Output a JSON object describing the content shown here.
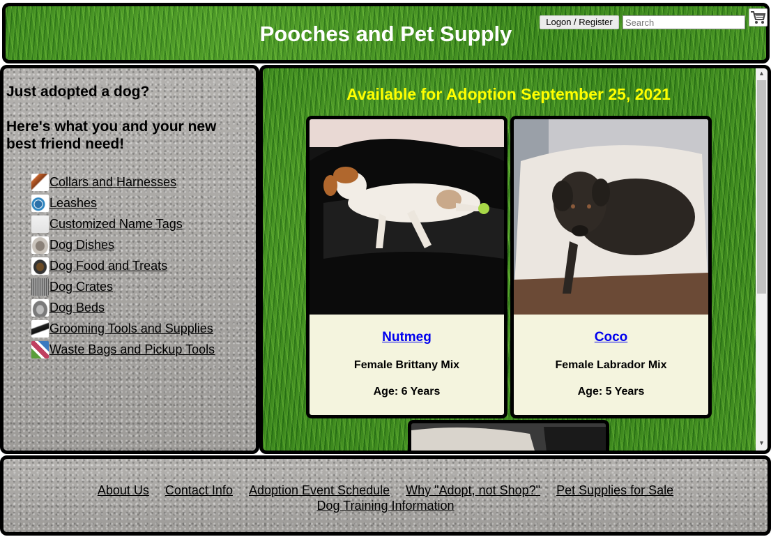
{
  "header": {
    "title": "Pooches and Pet Supply",
    "logon_label": "Logon / Register",
    "search_placeholder": "Search",
    "cart_icon": "shopping-cart-icon"
  },
  "sidebar": {
    "heading_1": "Just adopted a dog?",
    "heading_2": "Here's what you and your new best friend need!",
    "items": [
      {
        "label": "Collars and Harnesses",
        "icon": "collar-thumbnail"
      },
      {
        "label": "Leashes",
        "icon": "leash-thumbnail"
      },
      {
        "label": "Customized Name Tags",
        "icon": "name-tag-thumbnail"
      },
      {
        "label": "Dog Dishes",
        "icon": "dish-thumbnail"
      },
      {
        "label": "Dog Food and Treats",
        "icon": "food-thumbnail"
      },
      {
        "label": "Dog Crates",
        "icon": "crate-thumbnail"
      },
      {
        "label": "Dog Beds",
        "icon": "bed-thumbnail"
      },
      {
        "label": "Grooming Tools and Supplies",
        "icon": "grooming-thumbnail"
      },
      {
        "label": "Waste Bags and Pickup Tools",
        "icon": "waste-bag-thumbnail"
      }
    ]
  },
  "main": {
    "heading": "Available for Adoption September 25, 2021",
    "dogs": [
      {
        "name": "Nutmeg",
        "description": "Female Brittany Mix",
        "age": "Age: 6 Years"
      },
      {
        "name": "Coco",
        "description": "Female Labrador Mix",
        "age": "Age: 5 Years"
      }
    ]
  },
  "footer": {
    "links": [
      "About Us",
      "Contact Info",
      "Adoption Event Schedule",
      "Why \"Adopt, not Shop?\"",
      "Pet Supplies for Sale",
      "Dog Training Information"
    ]
  },
  "colors": {
    "heading_yellow": "#ffff00",
    "card_background": "#f4f4de",
    "dog_name_link": "#0000ee"
  }
}
